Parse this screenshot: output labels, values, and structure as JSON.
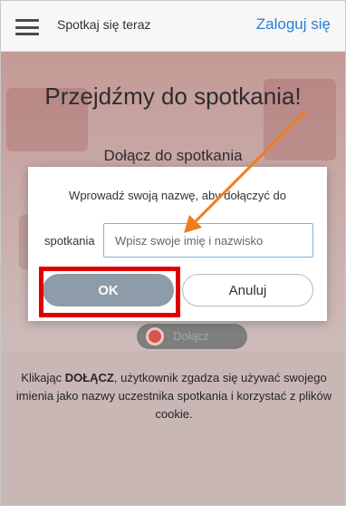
{
  "header": {
    "title": "Spotkaj się teraz",
    "login_label": "Zaloguj się",
    "menu_icon": "hamburger-menu-icon"
  },
  "background": {
    "heading": "Przejdźmy do spotkania!",
    "subheading": "Dołącz do spotkania",
    "join_label": "Dołącz",
    "notice_prefix": "Klikając ",
    "notice_bold": "DOŁĄCZ",
    "notice_suffix": ", użytkownik zgadza się używać swojego imienia jako nazwy uczestnika spotkania i korzystać z plików cookie."
  },
  "dialog": {
    "line1": "Wprowadź swoją nazwę, aby dołączyć do",
    "line2": "spotkania",
    "input_placeholder": "Wpisz swoje imię i nazwisko",
    "input_value": "",
    "ok_label": "OK",
    "cancel_label": "Anuluj"
  },
  "annotations": {
    "arrow_color": "#f07c1c",
    "highlight_color": "#e00000"
  }
}
